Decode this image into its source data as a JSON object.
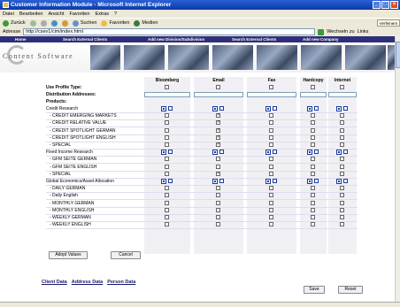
{
  "window": {
    "title": "Customer Information Module - Microsoft Internet Explorer"
  },
  "menu": [
    "Datei",
    "Bearbeiten",
    "Ansicht",
    "Favoriten",
    "Extras",
    "?"
  ],
  "toolbar": {
    "back": "Zurück",
    "search": "Suchen",
    "favorites": "Favoriten",
    "media": "Medien"
  },
  "address": {
    "label": "Adresse",
    "url": "http://csev1/cim/index.html",
    "go": "Wechseln zu",
    "links": "Links"
  },
  "popup": "Verfeinern",
  "nav": [
    "Home",
    "Search External Clients",
    "Add new Division/Subdivision",
    "Search External Clients",
    "Add new Company"
  ],
  "logo": "Content Software",
  "columns": [
    "Bloomberg",
    "Email",
    "Fax",
    "Hardcopy",
    "Internet"
  ],
  "labels": {
    "profile": "Use Profile Type:",
    "distribution": "Distribution Addresses:",
    "products": "Products:"
  },
  "rows": [
    {
      "label": "Credit Research",
      "group": true,
      "checks": [
        "b",
        "b",
        "b",
        "b",
        "b"
      ]
    },
    {
      "label": "- CREDIT EMERGING MARKETS",
      "checks": [
        "",
        "x",
        "",
        "",
        ""
      ]
    },
    {
      "label": "- CREDIT RELATIVE VALUE",
      "checks": [
        "",
        "x",
        "",
        "",
        ""
      ]
    },
    {
      "label": "- CREDIT SPOTLIGHT GERMAN",
      "checks": [
        "",
        "x",
        "",
        "",
        ""
      ]
    },
    {
      "label": "- CREDIT SPOTLIGHT ENGLISH",
      "checks": [
        "",
        "x",
        "",
        "",
        ""
      ]
    },
    {
      "label": "- SPECIAL",
      "checks": [
        "",
        "x",
        "",
        "",
        ""
      ]
    },
    {
      "label": "Fixed Income Research",
      "group": true,
      "checks": [
        "b",
        "b",
        "b",
        "b",
        "b"
      ]
    },
    {
      "label": "- GFM SEITE GERMAN",
      "checks": [
        "",
        "",
        "",
        "",
        ""
      ]
    },
    {
      "label": "- GFM SEITE ENGLISH",
      "checks": [
        "",
        "",
        "",
        "",
        ""
      ]
    },
    {
      "label": "- SPECIAL",
      "checks": [
        "",
        "x",
        "",
        "",
        ""
      ]
    },
    {
      "label": "Global Economics/Asset Allocation",
      "group": true,
      "checks": [
        "b",
        "b",
        "b",
        "b",
        "b"
      ]
    },
    {
      "label": "- DAILY GERMAN",
      "checks": [
        "",
        "",
        "",
        "",
        ""
      ]
    },
    {
      "label": "- Daily English",
      "checks": [
        "",
        "",
        "",
        "",
        ""
      ]
    },
    {
      "label": "- MONTHLY GERMAN",
      "checks": [
        "",
        "",
        "",
        "",
        ""
      ]
    },
    {
      "label": "- MONTHLY ENGLISH",
      "checks": [
        "",
        "",
        "",
        "",
        ""
      ]
    },
    {
      "label": "- WEEKLY GERMAN",
      "checks": [
        "",
        "",
        "",
        "",
        ""
      ]
    },
    {
      "label": "- WEEKLY ENGLISH",
      "checks": [
        "",
        "",
        "",
        "",
        ""
      ]
    }
  ],
  "buttons": {
    "adopt": "Adopt Values",
    "cancel": "Cancel",
    "save": "Save",
    "reset": "Reset"
  },
  "bottom_links": [
    "Client Data",
    "Address Data",
    "Person Data"
  ]
}
